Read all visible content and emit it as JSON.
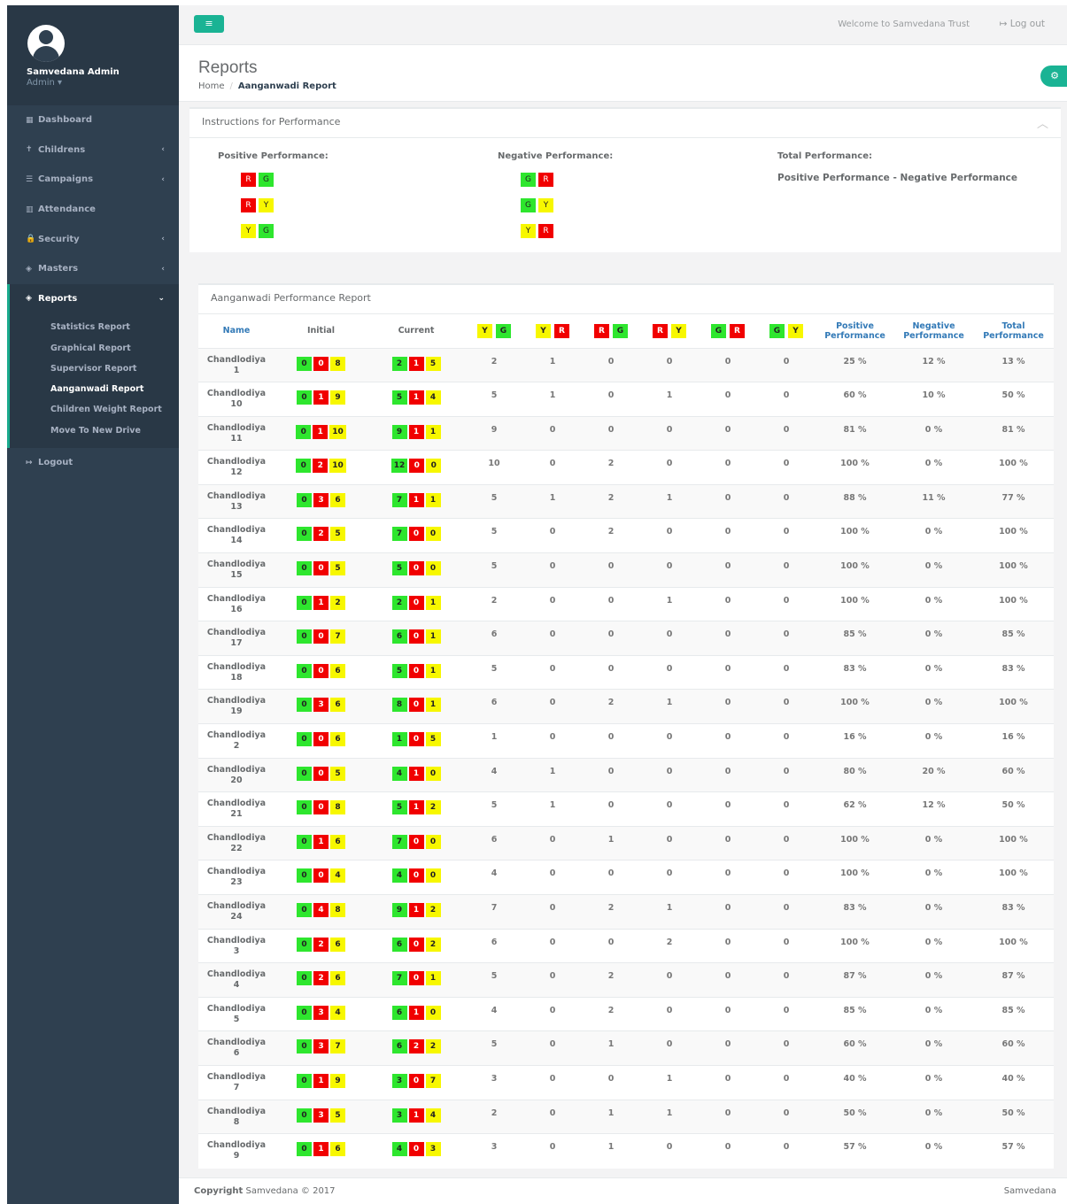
{
  "profile": {
    "name": "Samvedana Admin",
    "role": "Admin ▾"
  },
  "sidebar": {
    "items": [
      {
        "label": "Dashboard",
        "icon": "▦"
      },
      {
        "label": "Childrens",
        "icon": "✝",
        "chevron": "‹"
      },
      {
        "label": "Campaigns",
        "icon": "☰",
        "chevron": "‹"
      },
      {
        "label": "Attendance",
        "icon": "▥"
      },
      {
        "label": "Security",
        "icon": "🔒",
        "chevron": "‹"
      },
      {
        "label": "Masters",
        "icon": "◈",
        "chevron": "‹"
      }
    ],
    "reports": {
      "label": "Reports",
      "icon": "◈",
      "chevron": "⌄",
      "sub": [
        "Statistics Report",
        "Graphical Report",
        "Supervisor Report",
        "Aanganwadi Report",
        "Children Weight Report",
        "Move To New Drive"
      ]
    },
    "logout": {
      "label": "Logout",
      "icon": "↦"
    }
  },
  "topbar": {
    "menu": "≡",
    "welcome": "Welcome to Samvedana Trust",
    "logout": "↦ Log out"
  },
  "header": {
    "title": "Reports",
    "crumb_home": "Home",
    "crumb_sep": "/",
    "crumb_current": "Aanganwadi Report",
    "gear": "⚙"
  },
  "instructions": {
    "title": "Instructions for Performance",
    "collapse": "︿",
    "positive_label": "Positive Performance:",
    "negative_label": "Negative Performance:",
    "total_label": "Total Performance:",
    "total_formula": "Positive Performance - Negative Performance"
  },
  "report": {
    "title": "Aanganwadi Performance Report",
    "headers": {
      "name": "Name",
      "initial": "Initial",
      "current": "Current",
      "positive": "Positive Performance",
      "negative": "Negative Performance",
      "total": "Total Performance"
    },
    "rows": [
      {
        "n1": "Chandlodiya",
        "n2": "1",
        "i": [
          "0",
          "0",
          "8"
        ],
        "c": [
          "2",
          "1",
          "5"
        ],
        "v": [
          "2",
          "1",
          "0",
          "0",
          "0",
          "0"
        ],
        "p": "25 %",
        "ng": "12 %",
        "t": "13 %"
      },
      {
        "n1": "Chandlodiya",
        "n2": "10",
        "i": [
          "0",
          "1",
          "9"
        ],
        "c": [
          "5",
          "1",
          "4"
        ],
        "v": [
          "5",
          "1",
          "0",
          "1",
          "0",
          "0"
        ],
        "p": "60 %",
        "ng": "10 %",
        "t": "50 %"
      },
      {
        "n1": "Chandlodiya",
        "n2": "11",
        "i": [
          "0",
          "1",
          "10"
        ],
        "c": [
          "9",
          "1",
          "1"
        ],
        "v": [
          "9",
          "0",
          "0",
          "0",
          "0",
          "0"
        ],
        "p": "81 %",
        "ng": "0 %",
        "t": "81 %"
      },
      {
        "n1": "Chandlodiya",
        "n2": "12",
        "i": [
          "0",
          "2",
          "10"
        ],
        "c": [
          "12",
          "0",
          "0"
        ],
        "v": [
          "10",
          "0",
          "2",
          "0",
          "0",
          "0"
        ],
        "p": "100 %",
        "ng": "0 %",
        "t": "100 %"
      },
      {
        "n1": "Chandlodiya",
        "n2": "13",
        "i": [
          "0",
          "3",
          "6"
        ],
        "c": [
          "7",
          "1",
          "1"
        ],
        "v": [
          "5",
          "1",
          "2",
          "1",
          "0",
          "0"
        ],
        "p": "88 %",
        "ng": "11 %",
        "t": "77 %"
      },
      {
        "n1": "Chandlodiya",
        "n2": "14",
        "i": [
          "0",
          "2",
          "5"
        ],
        "c": [
          "7",
          "0",
          "0"
        ],
        "v": [
          "5",
          "0",
          "2",
          "0",
          "0",
          "0"
        ],
        "p": "100 %",
        "ng": "0 %",
        "t": "100 %"
      },
      {
        "n1": "Chandlodiya",
        "n2": "15",
        "i": [
          "0",
          "0",
          "5"
        ],
        "c": [
          "5",
          "0",
          "0"
        ],
        "v": [
          "5",
          "0",
          "0",
          "0",
          "0",
          "0"
        ],
        "p": "100 %",
        "ng": "0 %",
        "t": "100 %"
      },
      {
        "n1": "Chandlodiya",
        "n2": "16",
        "i": [
          "0",
          "1",
          "2"
        ],
        "c": [
          "2",
          "0",
          "1"
        ],
        "v": [
          "2",
          "0",
          "0",
          "1",
          "0",
          "0"
        ],
        "p": "100 %",
        "ng": "0 %",
        "t": "100 %"
      },
      {
        "n1": "Chandlodiya",
        "n2": "17",
        "i": [
          "0",
          "0",
          "7"
        ],
        "c": [
          "6",
          "0",
          "1"
        ],
        "v": [
          "6",
          "0",
          "0",
          "0",
          "0",
          "0"
        ],
        "p": "85 %",
        "ng": "0 %",
        "t": "85 %"
      },
      {
        "n1": "Chandlodiya",
        "n2": "18",
        "i": [
          "0",
          "0",
          "6"
        ],
        "c": [
          "5",
          "0",
          "1"
        ],
        "v": [
          "5",
          "0",
          "0",
          "0",
          "0",
          "0"
        ],
        "p": "83 %",
        "ng": "0 %",
        "t": "83 %"
      },
      {
        "n1": "Chandlodiya",
        "n2": "19",
        "i": [
          "0",
          "3",
          "6"
        ],
        "c": [
          "8",
          "0",
          "1"
        ],
        "v": [
          "6",
          "0",
          "2",
          "1",
          "0",
          "0"
        ],
        "p": "100 %",
        "ng": "0 %",
        "t": "100 %"
      },
      {
        "n1": "Chandlodiya",
        "n2": "2",
        "i": [
          "0",
          "0",
          "6"
        ],
        "c": [
          "1",
          "0",
          "5"
        ],
        "v": [
          "1",
          "0",
          "0",
          "0",
          "0",
          "0"
        ],
        "p": "16 %",
        "ng": "0 %",
        "t": "16 %"
      },
      {
        "n1": "Chandlodiya",
        "n2": "20",
        "i": [
          "0",
          "0",
          "5"
        ],
        "c": [
          "4",
          "1",
          "0"
        ],
        "v": [
          "4",
          "1",
          "0",
          "0",
          "0",
          "0"
        ],
        "p": "80 %",
        "ng": "20 %",
        "t": "60 %"
      },
      {
        "n1": "Chandlodiya",
        "n2": "21",
        "i": [
          "0",
          "0",
          "8"
        ],
        "c": [
          "5",
          "1",
          "2"
        ],
        "v": [
          "5",
          "1",
          "0",
          "0",
          "0",
          "0"
        ],
        "p": "62 %",
        "ng": "12 %",
        "t": "50 %"
      },
      {
        "n1": "Chandlodiya",
        "n2": "22",
        "i": [
          "0",
          "1",
          "6"
        ],
        "c": [
          "7",
          "0",
          "0"
        ],
        "v": [
          "6",
          "0",
          "1",
          "0",
          "0",
          "0"
        ],
        "p": "100 %",
        "ng": "0 %",
        "t": "100 %"
      },
      {
        "n1": "Chandlodiya",
        "n2": "23",
        "i": [
          "0",
          "0",
          "4"
        ],
        "c": [
          "4",
          "0",
          "0"
        ],
        "v": [
          "4",
          "0",
          "0",
          "0",
          "0",
          "0"
        ],
        "p": "100 %",
        "ng": "0 %",
        "t": "100 %"
      },
      {
        "n1": "Chandlodiya",
        "n2": "24",
        "i": [
          "0",
          "4",
          "8"
        ],
        "c": [
          "9",
          "1",
          "2"
        ],
        "v": [
          "7",
          "0",
          "2",
          "1",
          "0",
          "0"
        ],
        "p": "83 %",
        "ng": "0 %",
        "t": "83 %"
      },
      {
        "n1": "Chandlodiya",
        "n2": "3",
        "i": [
          "0",
          "2",
          "6"
        ],
        "c": [
          "6",
          "0",
          "2"
        ],
        "v": [
          "6",
          "0",
          "0",
          "2",
          "0",
          "0"
        ],
        "p": "100 %",
        "ng": "0 %",
        "t": "100 %"
      },
      {
        "n1": "Chandlodiya",
        "n2": "4",
        "i": [
          "0",
          "2",
          "6"
        ],
        "c": [
          "7",
          "0",
          "1"
        ],
        "v": [
          "5",
          "0",
          "2",
          "0",
          "0",
          "0"
        ],
        "p": "87 %",
        "ng": "0 %",
        "t": "87 %"
      },
      {
        "n1": "Chandlodiya",
        "n2": "5",
        "i": [
          "0",
          "3",
          "4"
        ],
        "c": [
          "6",
          "1",
          "0"
        ],
        "v": [
          "4",
          "0",
          "2",
          "0",
          "0",
          "0"
        ],
        "p": "85 %",
        "ng": "0 %",
        "t": "85 %"
      },
      {
        "n1": "Chandlodiya",
        "n2": "6",
        "i": [
          "0",
          "3",
          "7"
        ],
        "c": [
          "6",
          "2",
          "2"
        ],
        "v": [
          "5",
          "0",
          "1",
          "0",
          "0",
          "0"
        ],
        "p": "60 %",
        "ng": "0 %",
        "t": "60 %"
      },
      {
        "n1": "Chandlodiya",
        "n2": "7",
        "i": [
          "0",
          "1",
          "9"
        ],
        "c": [
          "3",
          "0",
          "7"
        ],
        "v": [
          "3",
          "0",
          "0",
          "1",
          "0",
          "0"
        ],
        "p": "40 %",
        "ng": "0 %",
        "t": "40 %"
      },
      {
        "n1": "Chandlodiya",
        "n2": "8",
        "i": [
          "0",
          "3",
          "5"
        ],
        "c": [
          "3",
          "1",
          "4"
        ],
        "v": [
          "2",
          "0",
          "1",
          "1",
          "0",
          "0"
        ],
        "p": "50 %",
        "ng": "0 %",
        "t": "50 %"
      },
      {
        "n1": "Chandlodiya",
        "n2": "9",
        "i": [
          "0",
          "1",
          "6"
        ],
        "c": [
          "4",
          "0",
          "3"
        ],
        "v": [
          "3",
          "0",
          "1",
          "0",
          "0",
          "0"
        ],
        "p": "57 %",
        "ng": "0 %",
        "t": "57 %"
      }
    ]
  },
  "footer": {
    "copyright_label": "Copyright",
    "copyright_text": "Samvedana © 2017",
    "right": "Samvedana"
  },
  "colors": {
    "green": "#2ee62e",
    "red": "#f10000",
    "yellow": "#f7f700",
    "sidebar": "#2f4050",
    "accent": "#1ab394"
  }
}
